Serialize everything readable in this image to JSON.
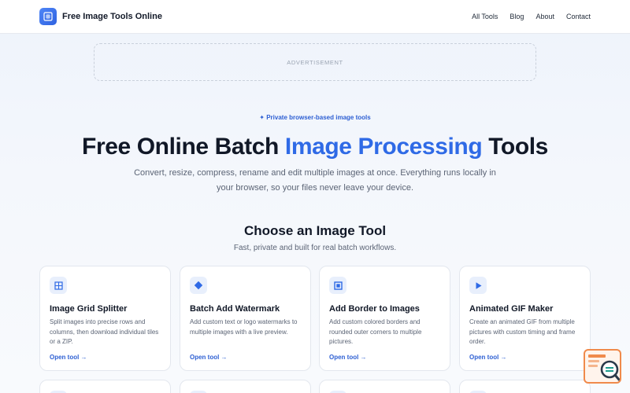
{
  "header": {
    "brand": "Free Image Tools Online",
    "nav": [
      "All Tools",
      "Blog",
      "About",
      "Contact"
    ]
  },
  "ad": {
    "label": "ADVERTISEMENT"
  },
  "hero": {
    "badge": "✦ Private browser-based image tools",
    "title_pre": "Free Online Batch ",
    "title_highlight": "Image Processing",
    "title_post": " Tools",
    "subtitle": "Convert, resize, compress, rename and edit multiple images at once. Everything runs locally in your browser, so your files never leave your device."
  },
  "section": {
    "title": "Choose an Image Tool",
    "subtitle": "Fast, private and built for real batch workflows."
  },
  "cards": [
    {
      "icon": "grid-icon",
      "title": "Image Grid Splitter",
      "desc": "Split images into precise rows and columns, then download individual tiles or a ZIP.",
      "link": "Open tool →"
    },
    {
      "icon": "diamond-icon",
      "title": "Batch Add Watermark",
      "desc": "Add custom text or logo watermarks to multiple images with a live preview.",
      "link": "Open tool →"
    },
    {
      "icon": "square-frame-icon",
      "title": "Add Border to Images",
      "desc": "Add custom colored borders and rounded outer corners to multiple pictures.",
      "link": "Open tool →"
    },
    {
      "icon": "play-icon",
      "title": "Animated GIF Maker",
      "desc": "Create an animated GIF from multiple pictures with custom timing and frame order.",
      "link": "Open tool →"
    }
  ],
  "colors": {
    "accent": "#2f6ae6",
    "link": "#2d5fd3",
    "text": "#111827",
    "muted": "#5b6475",
    "widget_orange": "#f08a4b"
  }
}
